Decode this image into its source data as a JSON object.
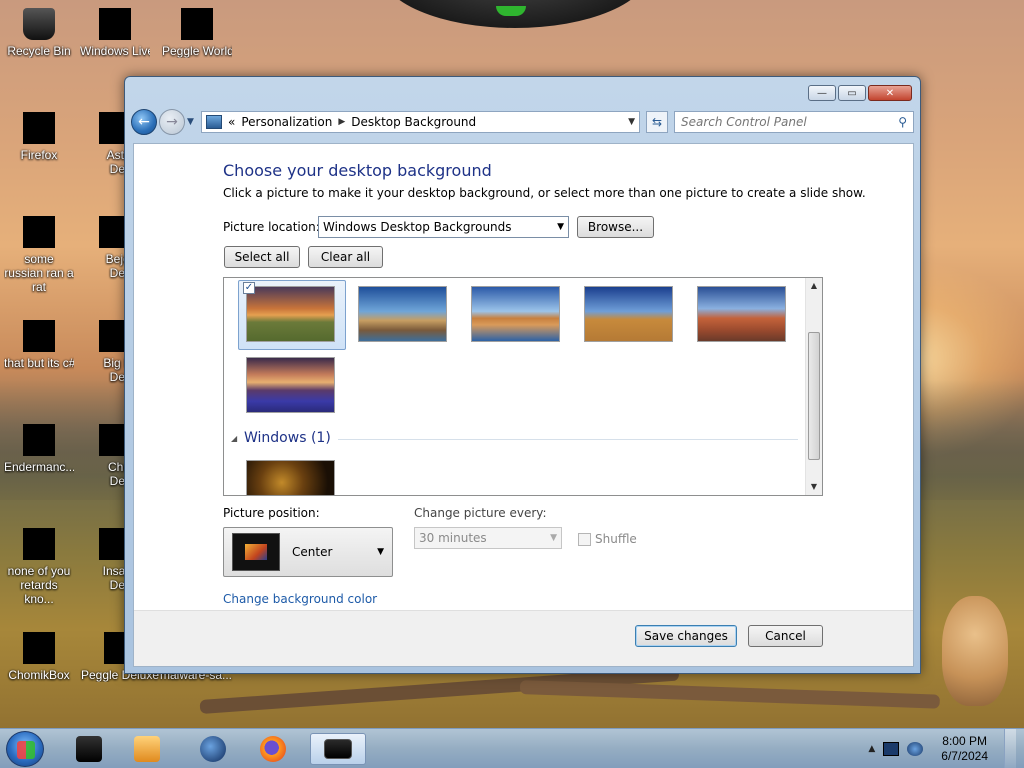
{
  "desktop": {
    "icons": [
      {
        "label": "Recycle Bin",
        "icon": "recycle-bin-icon"
      },
      {
        "label": "Windows Live Ma",
        "icon": "windows-live-mail-icon"
      },
      {
        "label": "Peggle World",
        "icon": "peggle-world-icon"
      },
      {
        "label": "Firefox",
        "icon": "firefox-icon"
      },
      {
        "label": "Astrol Delu",
        "icon": "game-icon"
      },
      {
        "label": "some russian ran a rat",
        "icon": "app-icon"
      },
      {
        "label": "Bejew Delu",
        "icon": "bejeweled-icon"
      },
      {
        "label": "that but its c#",
        "icon": "app-icon"
      },
      {
        "label": "Big Me Delu",
        "icon": "game-icon"
      },
      {
        "label": "Endermanc...",
        "icon": "app-icon"
      },
      {
        "label": "Chuz Delu",
        "icon": "game-icon"
      },
      {
        "label": "none of you retards kno...",
        "icon": "app-icon"
      },
      {
        "label": "Insaniq Delu",
        "icon": "game-icon"
      },
      {
        "label": "ChomikBox",
        "icon": "chomikbox-icon"
      },
      {
        "label": "Peggle Deluxe",
        "icon": "peggle-deluxe-icon"
      },
      {
        "label": "malware-sa...",
        "icon": "app-icon"
      }
    ]
  },
  "window": {
    "breadcrumb": [
      "Personalization",
      "Desktop Background"
    ],
    "breadcrumb_overflow": "«",
    "search_placeholder": "Search Control Panel",
    "title_buttons": {
      "minimize": "—",
      "maximize": "▭",
      "close": "✕"
    },
    "heading": "Choose your desktop background",
    "subtext": "Click a picture to make it your desktop background, or select more than one picture to create a slide show.",
    "picture_location_label": "Picture location:",
    "picture_location_value": "Windows Desktop Backgrounds",
    "browse_label": "Browse...",
    "select_all_label": "Select all",
    "clear_all_label": "Clear all",
    "gallery": {
      "group_label": "Windows (1)",
      "thumbnails": [
        "sunset-landscape",
        "lighthouse-coast",
        "rock-arch-lake",
        "hay-bale-field",
        "delicate-arch",
        "lupine-sunset",
        "windows-abstract"
      ],
      "selected_index": 0,
      "selected_check": "✓"
    },
    "picture_position_label": "Picture position:",
    "picture_position_value": "Center",
    "change_picture_label": "Change picture every:",
    "change_picture_value": "30 minutes",
    "shuffle_label": "Shuffle",
    "bg_color_link": "Change background color",
    "save_label": "Save changes",
    "cancel_label": "Cancel"
  },
  "taskbar": {
    "clock_time": "8:00 PM",
    "clock_date": "6/7/2024",
    "items": [
      "app-icon",
      "media-player-icon",
      "globe-icon",
      "firefox-icon",
      "control-panel-icon"
    ]
  },
  "colors": {
    "heading_blue": "#1e3287",
    "link_blue": "#1e5ba8"
  }
}
